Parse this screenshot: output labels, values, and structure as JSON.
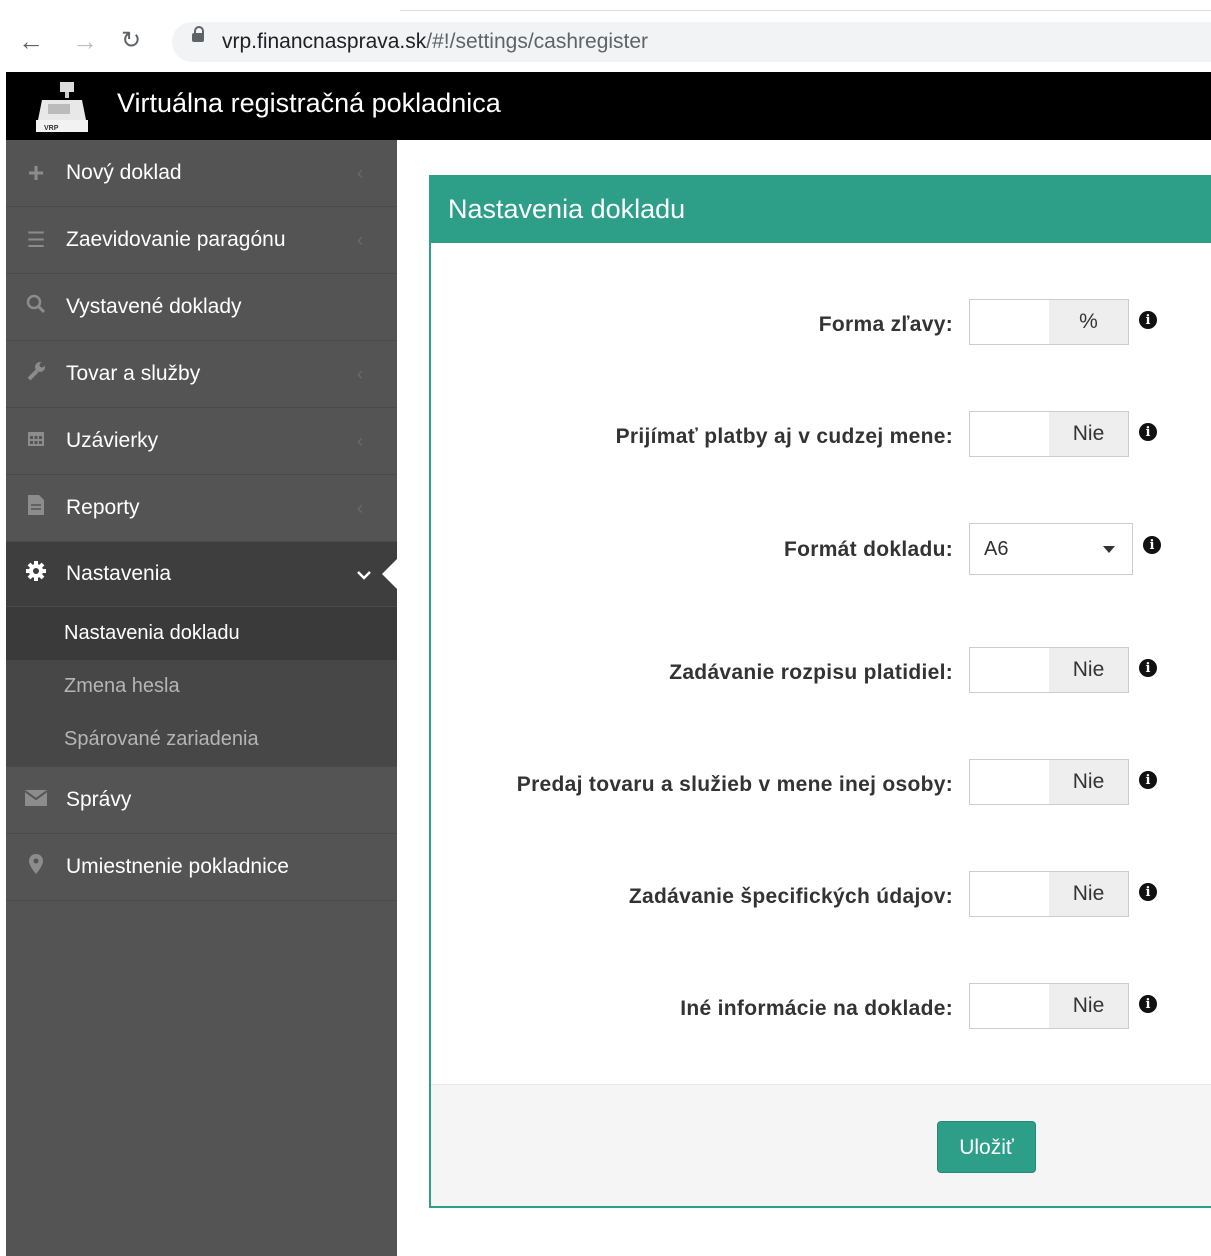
{
  "browser": {
    "url_host": "vrp.financnasprava.sk",
    "url_path": "/#!/settings/cashregister"
  },
  "app": {
    "title": "Virtuálna registračná pokladnica",
    "logo_text": "VRP"
  },
  "sidebar": {
    "items": [
      {
        "label": "Nový doklad",
        "icon": "plus-icon"
      },
      {
        "label": "Zaevidovanie paragónu",
        "icon": "document-stack-icon"
      },
      {
        "label": "Vystavené doklady",
        "icon": "search-icon"
      },
      {
        "label": "Tovar a služby",
        "icon": "wrench-icon"
      },
      {
        "label": "Uzávierky",
        "icon": "calendar-icon"
      },
      {
        "label": "Reporty",
        "icon": "file-icon"
      },
      {
        "label": "Nastavenia",
        "icon": "gear-icon"
      },
      {
        "label": "Správy",
        "icon": "envelope-icon"
      },
      {
        "label": "Umiestnenie pokladnice",
        "icon": "map-marker-icon"
      }
    ],
    "submenu": [
      {
        "label": "Nastavenia dokladu"
      },
      {
        "label": "Zmena hesla"
      },
      {
        "label": "Spárované zariadenia"
      }
    ]
  },
  "panel": {
    "title": "Nastavenia dokladu",
    "rows": [
      {
        "label": "Forma zľavy:",
        "value": "%"
      },
      {
        "label": "Prijímať platby aj v cudzej mene:",
        "value": "Nie"
      },
      {
        "label": "Formát dokladu:",
        "value": "A6"
      },
      {
        "label": "Zadávanie rozpisu platidiel:",
        "value": "Nie"
      },
      {
        "label": "Predaj tovaru a služieb v mene inej osoby:",
        "value": "Nie"
      },
      {
        "label": "Zadávanie špecifických údajov:",
        "value": "Nie"
      },
      {
        "label": "Iné informácie na doklade:",
        "value": "Nie"
      }
    ],
    "save_label": "Uložiť"
  },
  "colors": {
    "accent": "#2d9f89",
    "sidebar_bg": "#545454",
    "header_bg": "#000000"
  }
}
